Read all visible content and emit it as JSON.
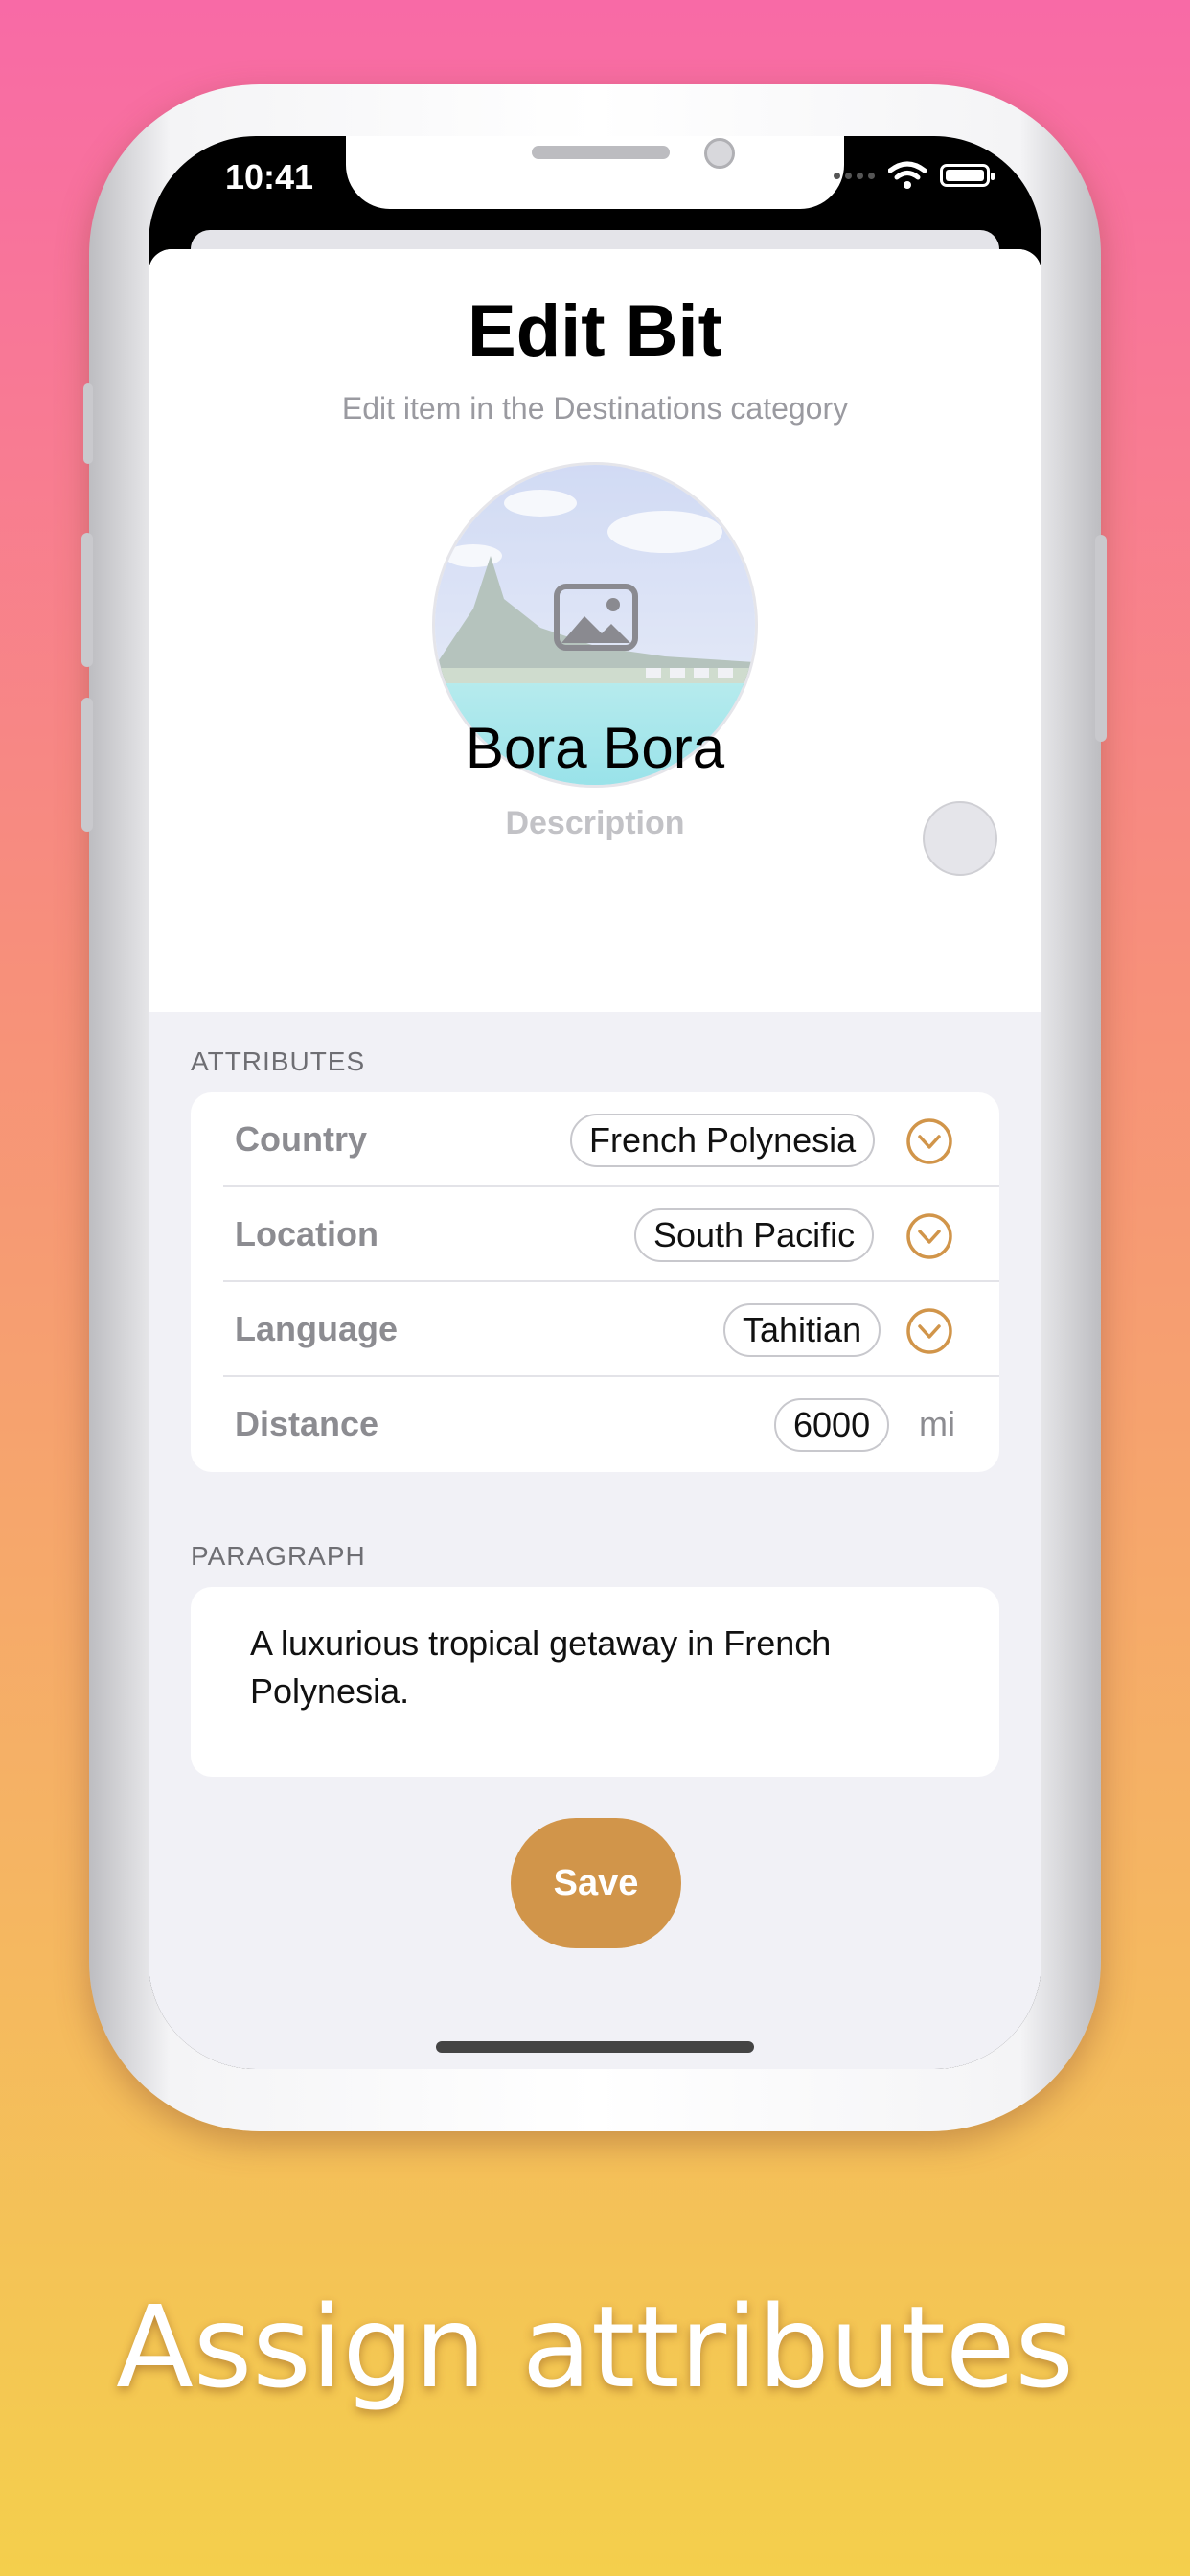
{
  "status_bar": {
    "time": "10:41"
  },
  "header": {
    "title": "Edit Bit",
    "subtitle": "Edit item in the Destinations category"
  },
  "item": {
    "name": "Bora Bora",
    "description_placeholder": "Description"
  },
  "attributes": {
    "section_label": "ATTRIBUTES",
    "rows": [
      {
        "label": "Country",
        "value": "French Polynesia"
      },
      {
        "label": "Location",
        "value": "South Pacific"
      },
      {
        "label": "Language",
        "value": "Tahitian"
      },
      {
        "label": "Distance",
        "value": "6000",
        "unit": "mi"
      }
    ]
  },
  "paragraph": {
    "section_label": "PARAGRAPH",
    "text": "A luxurious tropical getaway in French Polynesia."
  },
  "actions": {
    "save_label": "Save"
  },
  "tagline": "Assign attributes",
  "colors": {
    "accent": "#d1954a",
    "chevron": "#d1954a"
  },
  "icons": [
    "wifi-icon",
    "battery-icon",
    "photo-icon",
    "chevron-down-icon"
  ]
}
